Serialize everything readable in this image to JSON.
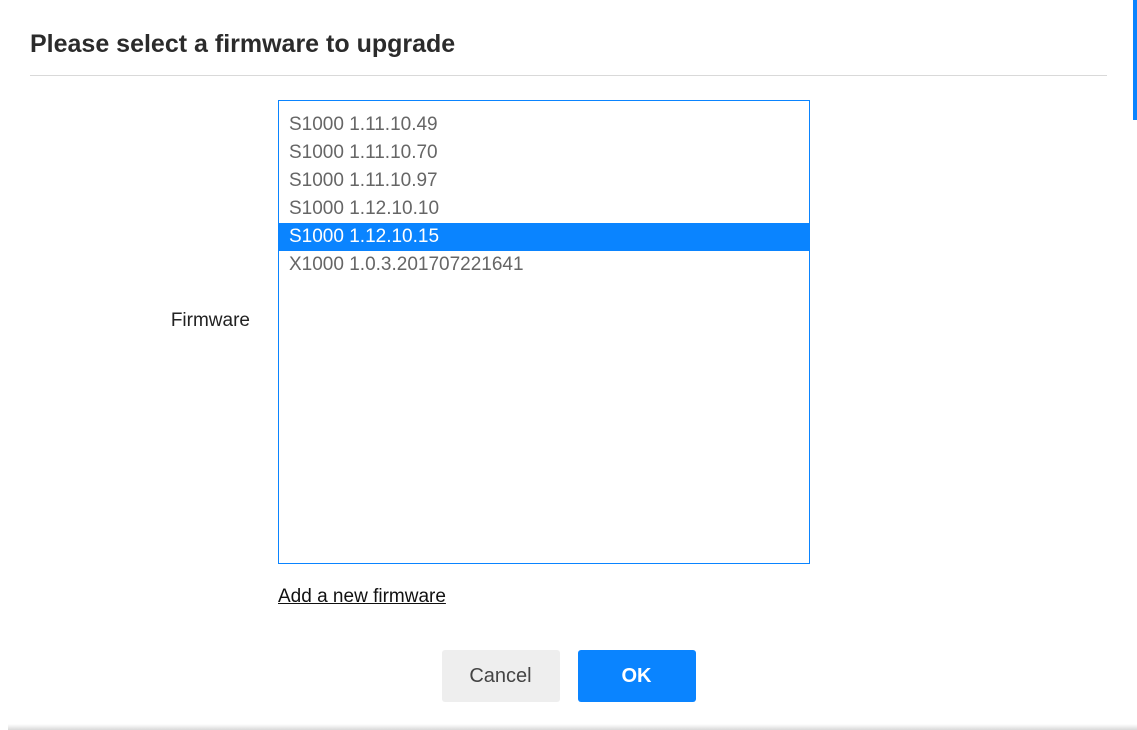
{
  "title": "Please select a firmware to upgrade",
  "field_label": "Firmware",
  "options": [
    {
      "label": "S1000 1.11.10.49",
      "selected": false
    },
    {
      "label": "S1000 1.11.10.70",
      "selected": false
    },
    {
      "label": "S1000 1.11.10.97",
      "selected": false
    },
    {
      "label": "S1000 1.12.10.10",
      "selected": false
    },
    {
      "label": "S1000 1.12.10.15",
      "selected": true
    },
    {
      "label": "X1000 1.0.3.201707221641",
      "selected": false
    }
  ],
  "add_link": "Add a new firmware",
  "buttons": {
    "cancel": "Cancel",
    "ok": "OK"
  },
  "colors": {
    "accent": "#0a84ff"
  }
}
